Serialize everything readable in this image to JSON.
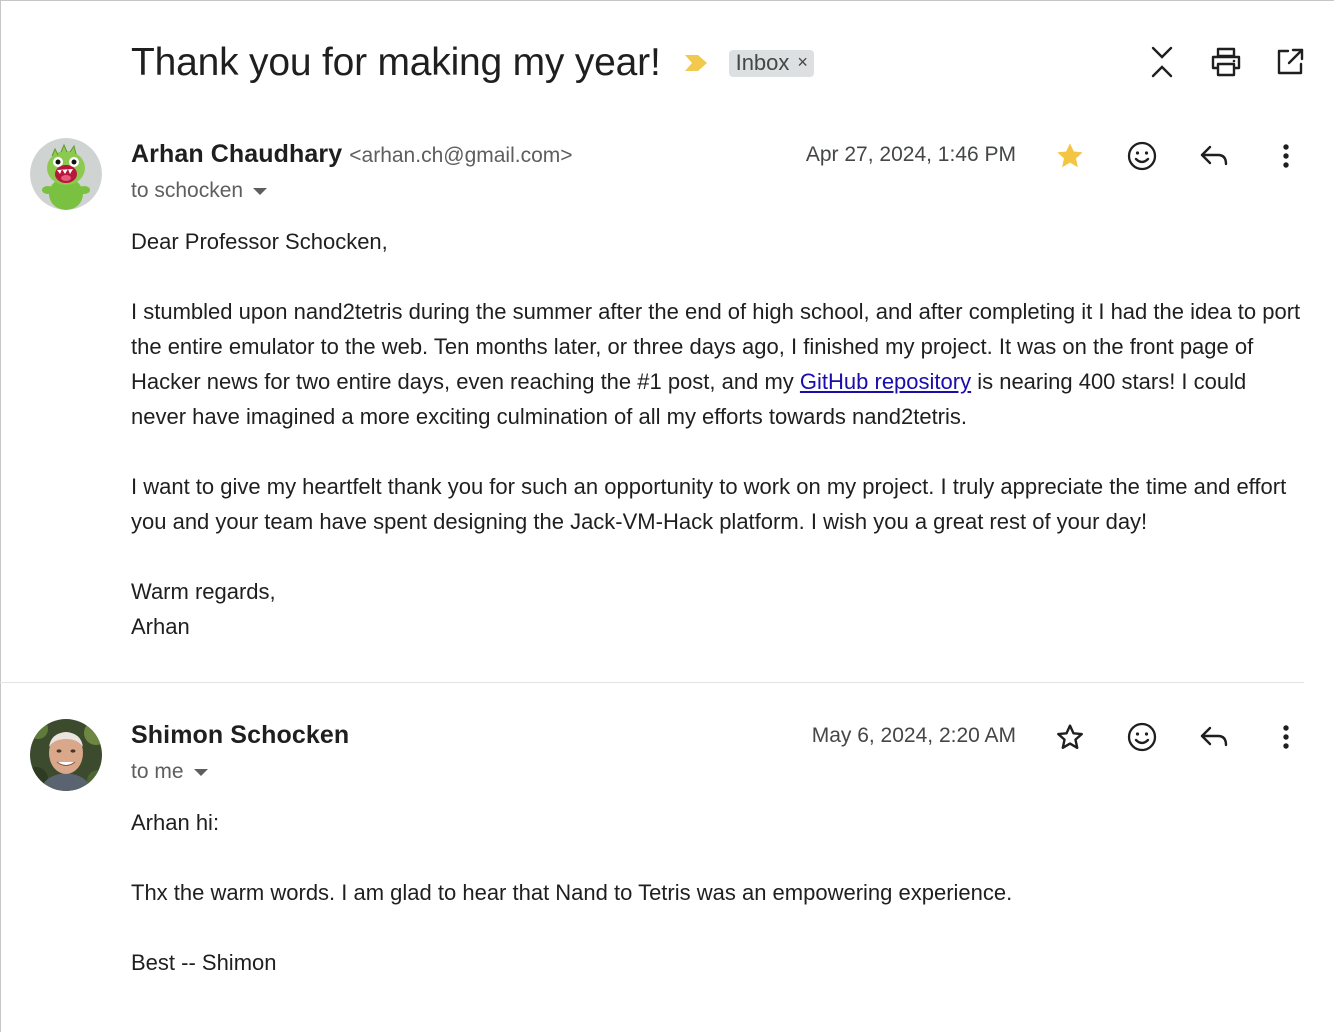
{
  "thread": {
    "subject": "Thank you for making my year!",
    "label": "Inbox",
    "label_remove": "×"
  },
  "top_actions": {
    "collapse_icon": "collapse-all-icon",
    "print_icon": "print-icon",
    "open_new_window_icon": "open-in-new-window-icon"
  },
  "messages": [
    {
      "sender_name": "Arhan Chaudhary",
      "sender_email": "<arhan.ch@gmail.com>",
      "to": "to schocken",
      "date": "Apr 27, 2024, 1:46 PM",
      "starred": true,
      "greeting": "Dear Professor Schocken,",
      "para1_before_link": "I stumbled upon nand2tetris during the summer after the end of high school, and after completing it I had the idea to port the entire emulator to the web. Ten months later, or three days ago, I finished my project. It was on the front page of Hacker news for two entire days, even reaching the #1 post, and my ",
      "para1_link": "GitHub repository",
      "para1_after_link": " is nearing 400 stars! I could never have imagined a more exciting culmination of all my efforts towards nand2tetris.",
      "para2": "I want to give my heartfelt thank you for such an opportunity to work on my project. I truly appreciate the time and effort you and your team have spent designing the Jack-VM-Hack platform. I wish you a great rest of your day!",
      "signoff_1": "Warm regards,",
      "signoff_2": "Arhan"
    },
    {
      "sender_name": "Shimon Schocken",
      "to": "to me",
      "date": "May 6, 2024, 2:20 AM",
      "starred": false,
      "greeting": "Arhan hi:",
      "para1": "Thx the warm words. I am glad to hear that Nand to Tetris was an empowering experience.",
      "signoff": "Best -- Shimon"
    }
  ],
  "colors": {
    "star_filled": "#f4c542",
    "importance": "#f2c94c",
    "link": "#1a0dab",
    "chip_bg": "#dde0e3"
  }
}
